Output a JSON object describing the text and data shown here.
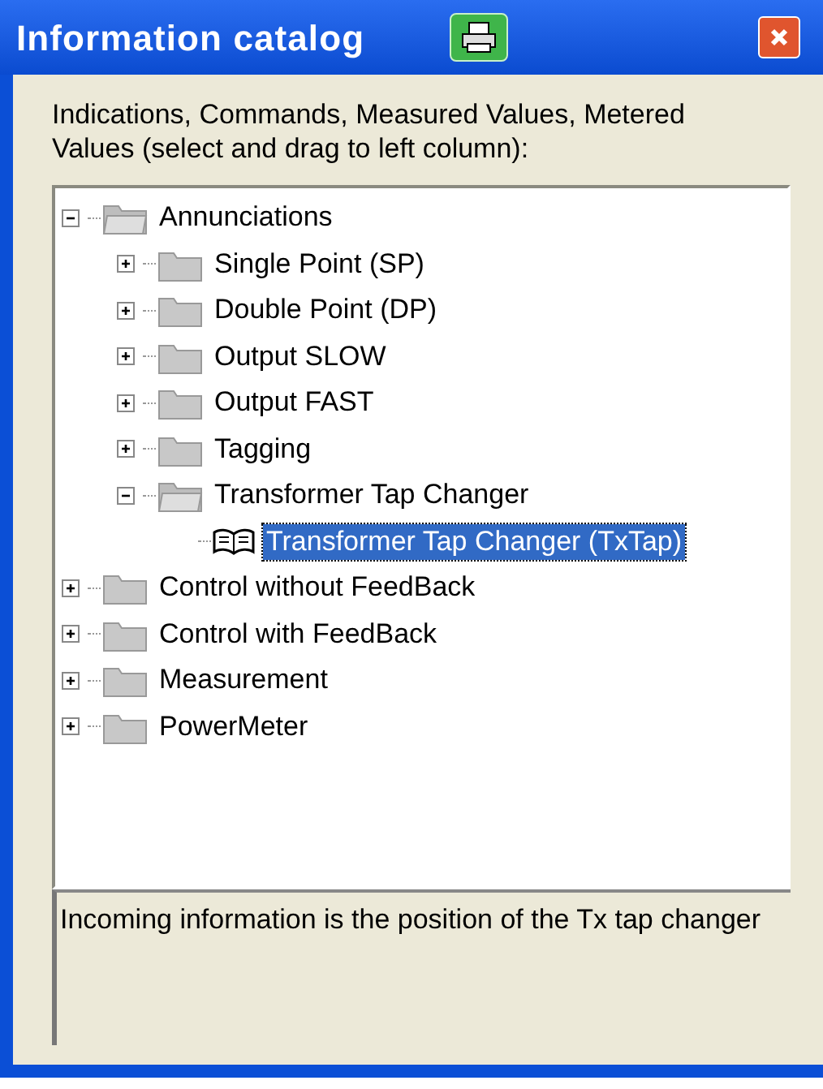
{
  "window": {
    "title": "Information catalog"
  },
  "instructions": "Indications, Commands, Measured Values, Metered Values (select and drag to left column):",
  "tree": [
    {
      "label": "Annunciations",
      "kind": "folder",
      "expanded": true,
      "selected": false,
      "children": [
        {
          "label": "Single Point (SP)",
          "kind": "folder",
          "expanded": false,
          "selected": false
        },
        {
          "label": "Double Point (DP)",
          "kind": "folder",
          "expanded": false,
          "selected": false
        },
        {
          "label": "Output SLOW",
          "kind": "folder",
          "expanded": false,
          "selected": false
        },
        {
          "label": "Output FAST",
          "kind": "folder",
          "expanded": false,
          "selected": false
        },
        {
          "label": "Tagging",
          "kind": "folder",
          "expanded": false,
          "selected": false
        },
        {
          "label": "Transformer Tap Changer",
          "kind": "folder",
          "expanded": true,
          "selected": false,
          "children": [
            {
              "label": "Transformer Tap Changer (TxTap)",
              "kind": "leaf",
              "selected": true
            }
          ]
        }
      ]
    },
    {
      "label": "Control without FeedBack",
      "kind": "folder",
      "expanded": false,
      "selected": false
    },
    {
      "label": "Control with FeedBack",
      "kind": "folder",
      "expanded": false,
      "selected": false
    },
    {
      "label": "Measurement",
      "kind": "folder",
      "expanded": false,
      "selected": false
    },
    {
      "label": "PowerMeter",
      "kind": "folder",
      "expanded": false,
      "selected": false
    }
  ],
  "description": "Incoming information is the position of the Tx tap changer"
}
